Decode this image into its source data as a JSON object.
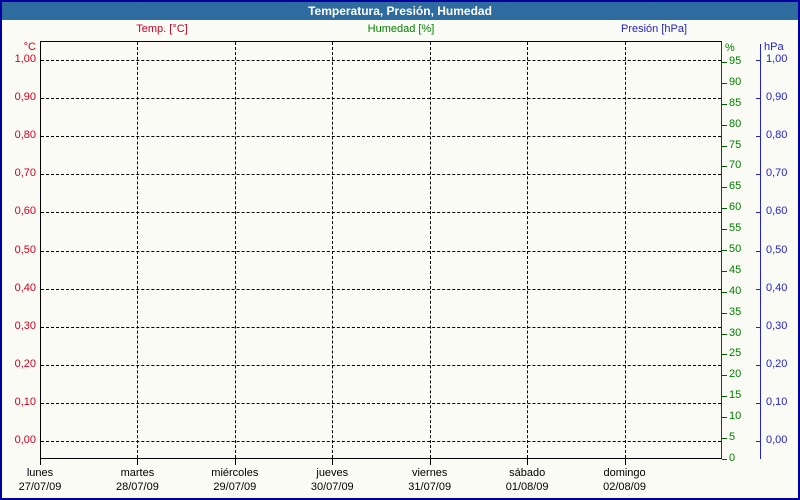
{
  "window": {
    "title": "Temperatura, Presión, Humedad"
  },
  "colors": {
    "temperature": "#cc0022",
    "humidity": "#008000",
    "humidity_axis_line": "#005800",
    "pressure": "#2323cc",
    "titlebar_bg": "#2e6b9e",
    "window_border": "#0000a0",
    "grid": "#000000"
  },
  "legend": [
    {
      "label": "Temp. [°C]",
      "color": "#cc0022"
    },
    {
      "label": "Humedad [%]",
      "color": "#008000"
    },
    {
      "label": "Presión [hPa]",
      "color": "#2323cc"
    }
  ],
  "chart_data": {
    "type": "line",
    "title": "Temperatura, Presión, Humedad",
    "grid": true,
    "legend_position": "top",
    "plot_empty_note": "Grid and axes are drawn but no data points are plotted",
    "series": [
      {
        "name": "Temp. [°C]",
        "unit": "°C",
        "axis": "left",
        "color": "#cc0022",
        "values": []
      },
      {
        "name": "Humedad [%]",
        "unit": "%",
        "axis": "right_inner",
        "color": "#008000",
        "values": []
      },
      {
        "name": "Presión [hPa]",
        "unit": "hPa",
        "axis": "right_outer",
        "color": "#2323cc",
        "values": []
      }
    ],
    "x_axis": {
      "day_names": [
        "lunes",
        "martes",
        "miércoles",
        "jueves",
        "viernes",
        "sábado",
        "domingo"
      ],
      "dates": [
        "27/07/09",
        "28/07/09",
        "29/07/09",
        "30/07/09",
        "31/07/09",
        "01/08/09",
        "02/08/09"
      ]
    },
    "y_axes": {
      "temperature": {
        "unit": "°C",
        "tick_labels": [
          "1,00",
          "0,90",
          "0,80",
          "0,70",
          "0,60",
          "0,50",
          "0,40",
          "0,30",
          "0,20",
          "0,10",
          "0,00"
        ],
        "range": [
          0,
          1
        ]
      },
      "humidity": {
        "unit": "%",
        "tick_labels": [
          "95",
          "90",
          "85",
          "80",
          "75",
          "70",
          "65",
          "60",
          "55",
          "50",
          "45",
          "40",
          "35",
          "30",
          "25",
          "20",
          "15",
          "10",
          "5",
          "0"
        ],
        "range": [
          0,
          100
        ]
      },
      "pressure": {
        "unit": "hPa",
        "tick_labels": [
          "1,00",
          "0,90",
          "0,80",
          "0,70",
          "0,60",
          "0,50",
          "0,40",
          "0,30",
          "0,20",
          "0,10",
          "0,00"
        ],
        "range": [
          0,
          1
        ]
      }
    }
  }
}
